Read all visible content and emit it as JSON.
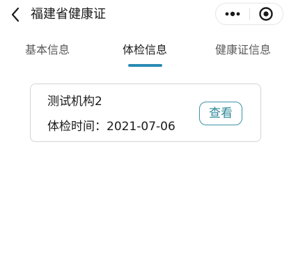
{
  "nav": {
    "title": "福建省健康证",
    "back_icon": "chevron-left-icon",
    "more_icon": "more-dots-icon",
    "close_icon": "target-circle-icon"
  },
  "tabs": [
    {
      "label": "基本信息",
      "active": false
    },
    {
      "label": "体检信息",
      "active": true
    },
    {
      "label": "健康证信息",
      "active": false
    }
  ],
  "record": {
    "org": "测试机构2",
    "date_label": "体检时间：",
    "date": "2021-07-06",
    "view_label": "查看"
  },
  "colors": {
    "accent": "#2b8ab4",
    "button_border": "#3a93a6",
    "card_border": "#d3d3d3"
  }
}
